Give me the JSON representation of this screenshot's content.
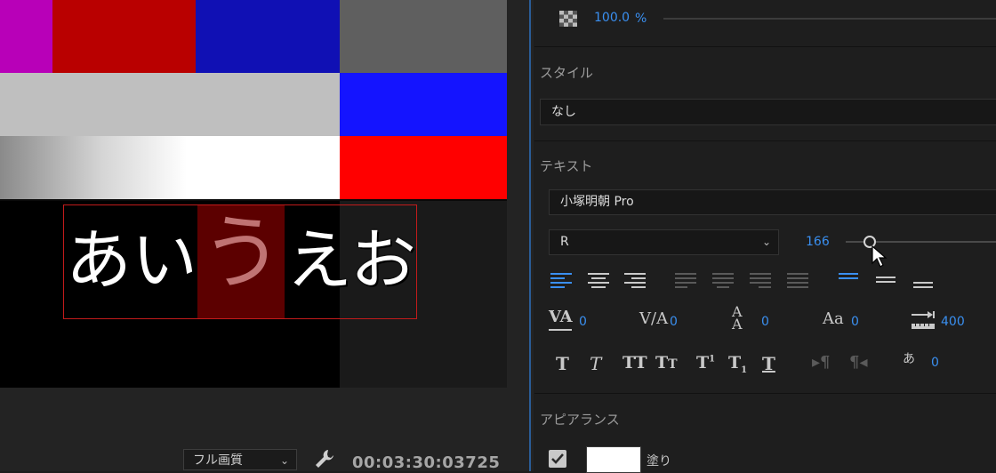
{
  "monitor": {
    "title_chars": [
      "あ",
      "い",
      "う",
      "え",
      "お"
    ],
    "quality": "フル画質",
    "timecode": "00:03:30:03725",
    "wrench_icon": "wrench-icon",
    "colors": {
      "title_box_border": "#c21b1b",
      "selected_char_bg": "#5c0000"
    }
  },
  "panel": {
    "opacity": {
      "value": "100.0",
      "unit": "%",
      "icon": "checker-icon"
    },
    "style": {
      "label": "スタイル",
      "value": "なし"
    },
    "text": {
      "label": "テキスト",
      "font_family": "小塚明朝 Pro",
      "font_style": "R",
      "font_size": "166",
      "font_size_slider_fraction": 0.16,
      "kerning": "0",
      "tracking": "0",
      "leading": "0",
      "baseline_shift": "0",
      "tab_width": "400",
      "tsume": "0"
    },
    "appearance": {
      "label": "アピアランス",
      "fill_label": "塗り",
      "fill_checked": true,
      "fill_color": "#ffffff"
    },
    "accent_color": "#3a8ff0"
  }
}
